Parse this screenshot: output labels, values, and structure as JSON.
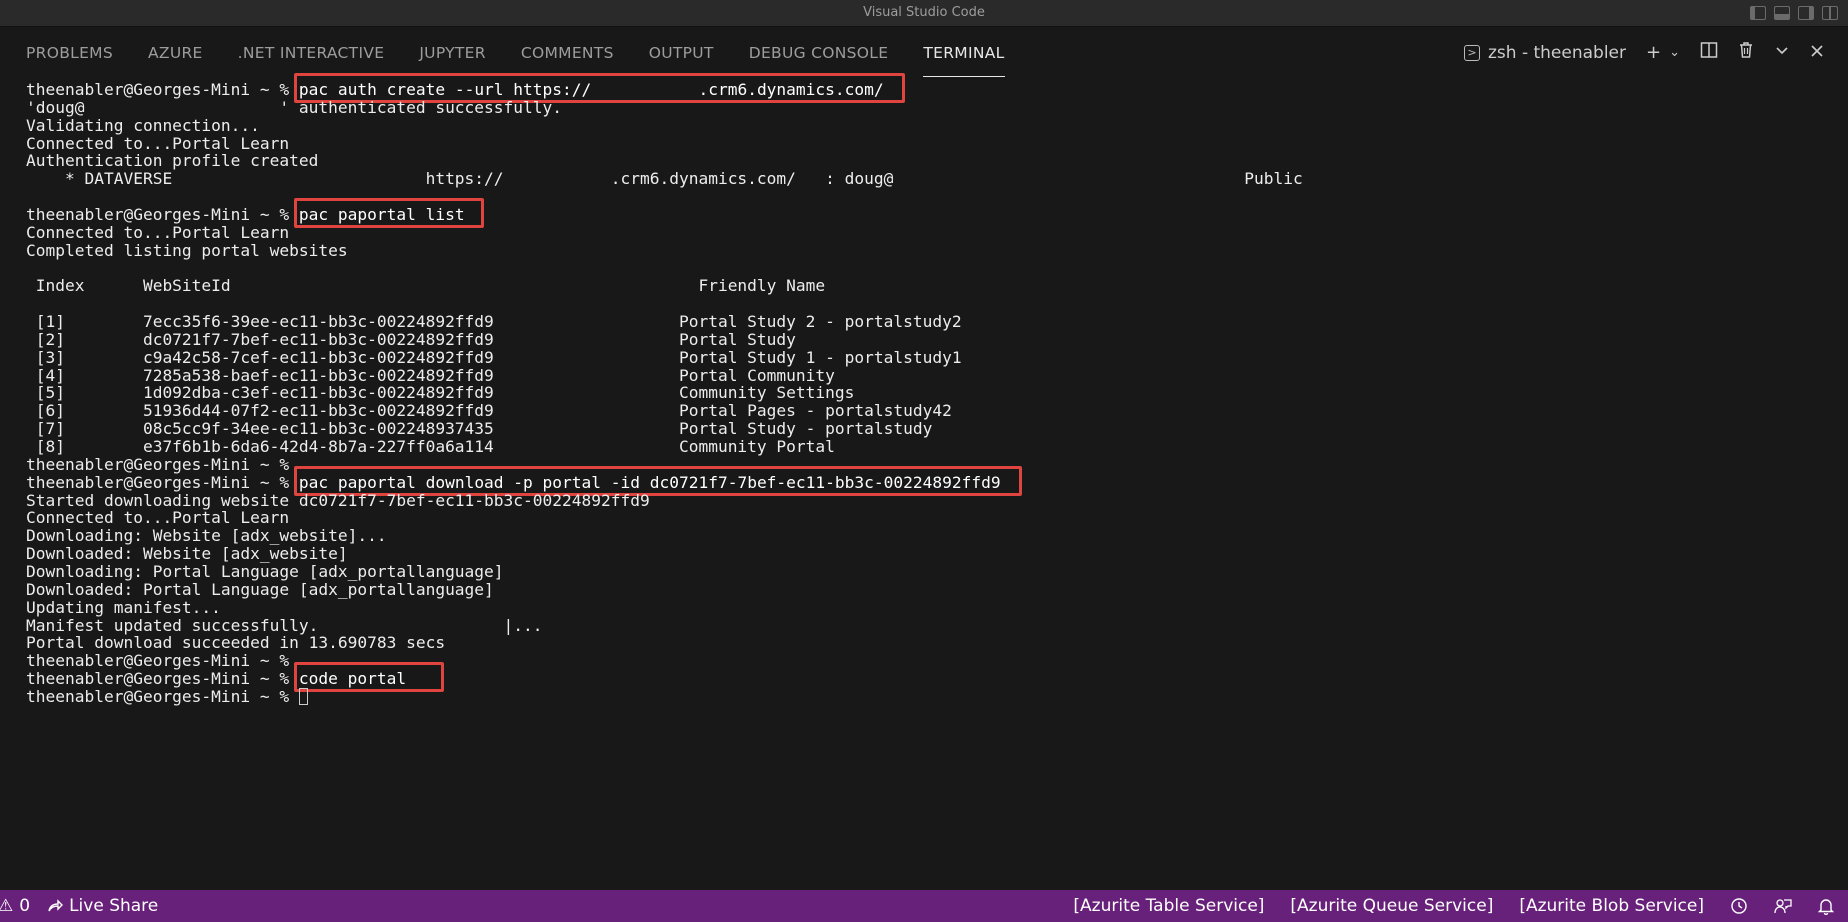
{
  "window": {
    "title": "Visual Studio Code"
  },
  "panel": {
    "tabs": [
      {
        "label": "PROBLEMS"
      },
      {
        "label": "AZURE"
      },
      {
        "label": ".NET INTERACTIVE"
      },
      {
        "label": "JUPYTER"
      },
      {
        "label": "COMMENTS"
      },
      {
        "label": "OUTPUT"
      },
      {
        "label": "DEBUG CONSOLE"
      },
      {
        "label": "TERMINAL",
        "active": true
      }
    ],
    "terminal_name": "zsh - theenabler",
    "icons": [
      "terminal-icon",
      "plus-icon",
      "chevron-down-icon",
      "split-icon",
      "trash-icon",
      "chevron-up-icon",
      "close-icon"
    ]
  },
  "terminal": {
    "prompt": "theenabler@Georges-Mini ~ % ",
    "lines": [
      {
        "prompt": "theenabler@Georges-Mini ~ % ",
        "text": "pac auth create --url https://           .crm6.dynamics.com/",
        "highlight": true
      },
      {
        "text": "'doug@                    ' authenticated successfully."
      },
      {
        "text": "Validating connection..."
      },
      {
        "text": "Connected to...Portal Learn"
      },
      {
        "text": "Authentication profile created"
      },
      {
        "text": "    * DATAVERSE                          https://           .crm6.dynamics.com/   : doug@                                    Public"
      },
      {
        "text": ""
      },
      {
        "prompt": "theenabler@Georges-Mini ~ % ",
        "text": "pac paportal list",
        "highlight": true
      },
      {
        "text": "Connected to...Portal Learn"
      },
      {
        "text": "Completed listing portal websites"
      },
      {
        "text": ""
      },
      {
        "text": " Index      WebSiteId                                                Friendly Name"
      },
      {
        "text": ""
      },
      {
        "text": " [1]        7ecc35f6-39ee-ec11-bb3c-00224892ffd9                   Portal Study 2 - portalstudy2"
      },
      {
        "text": " [2]        dc0721f7-7bef-ec11-bb3c-00224892ffd9                   Portal Study"
      },
      {
        "text": " [3]        c9a42c58-7cef-ec11-bb3c-00224892ffd9                   Portal Study 1 - portalstudy1"
      },
      {
        "text": " [4]        7285a538-baef-ec11-bb3c-00224892ffd9                   Portal Community"
      },
      {
        "text": " [5]        1d092dba-c3ef-ec11-bb3c-00224892ffd9                   Community Settings"
      },
      {
        "text": " [6]        51936d44-07f2-ec11-bb3c-00224892ffd9                   Portal Pages - portalstudy42"
      },
      {
        "text": " [7]        08c5cc9f-34ee-ec11-bb3c-002248937435                   Portal Study - portalstudy"
      },
      {
        "text": " [8]        e37f6b1b-6da6-42d4-8b7a-227ff0a6a114                   Community Portal"
      },
      {
        "prompt": "theenabler@Georges-Mini ~ % ",
        "text": ""
      },
      {
        "prompt": "theenabler@Georges-Mini ~ % ",
        "text": "pac paportal download -p portal -id dc0721f7-7bef-ec11-bb3c-00224892ffd9",
        "highlight": true
      },
      {
        "text": "Started downloading website dc0721f7-7bef-ec11-bb3c-00224892ffd9"
      },
      {
        "text": "Connected to...Portal Learn"
      },
      {
        "text": "Downloading: Website [adx_website]..."
      },
      {
        "text": "Downloaded: Website [adx_website]"
      },
      {
        "text": "Downloading: Portal Language [adx_portallanguage]"
      },
      {
        "text": "Downloaded: Portal Language [adx_portallanguage]"
      },
      {
        "text": "Updating manifest..."
      },
      {
        "text": "Manifest updated successfully.                   |..."
      },
      {
        "text": "Portal download succeeded in 13.690783 secs"
      },
      {
        "prompt": "theenabler@Georges-Mini ~ % ",
        "text": ""
      },
      {
        "prompt": "theenabler@Georges-Mini ~ % ",
        "text": "code portal",
        "highlight": true
      },
      {
        "prompt": "theenabler@Georges-Mini ~ % ",
        "text": "",
        "cursor": true
      }
    ]
  },
  "statusbar": {
    "problems_count": "0",
    "live_share": "Live Share",
    "right_items": [
      "[Azurite Table Service]",
      "[Azurite Queue Service]",
      "[Azurite Blob Service]"
    ]
  },
  "colors": {
    "statusbar": "#68217a",
    "highlight_box": "#e0443e",
    "background": "#181818"
  }
}
